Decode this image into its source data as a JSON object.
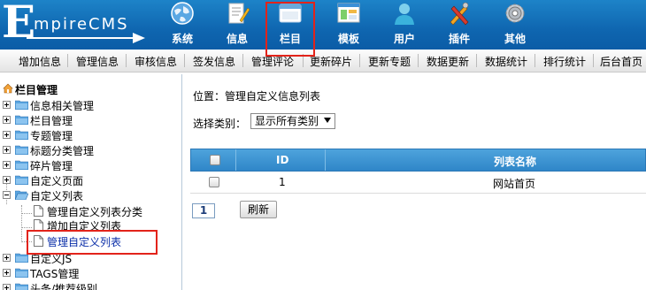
{
  "logo": {
    "big_letter": "E",
    "rest": "mpireCMS"
  },
  "nav": [
    {
      "label": "系统",
      "icon": "globe-icon"
    },
    {
      "label": "信息",
      "icon": "notepad-icon"
    },
    {
      "label": "栏目",
      "icon": "window-icon"
    },
    {
      "label": "模板",
      "icon": "template-window-icon"
    },
    {
      "label": "用户",
      "icon": "user-icon"
    },
    {
      "label": "插件",
      "icon": "plugin-tools-icon"
    },
    {
      "label": "其他",
      "icon": "gear-icon"
    }
  ],
  "submenu": [
    "增加信息",
    "管理信息",
    "审核信息",
    "签发信息",
    "管理评论",
    "更新碎片",
    "更新专题",
    "数据更新",
    "数据统计",
    "排行统计",
    "后台首页"
  ],
  "sidebar": {
    "title": "栏目管理",
    "items": [
      {
        "label": "信息相关管理"
      },
      {
        "label": "栏目管理"
      },
      {
        "label": "专题管理"
      },
      {
        "label": "标题分类管理"
      },
      {
        "label": "碎片管理"
      },
      {
        "label": "自定义页面"
      },
      {
        "label": "自定义列表"
      },
      {
        "label": "管理自定义列表分类"
      },
      {
        "label": "增加自定义列表"
      },
      {
        "label": "管理自定义列表"
      },
      {
        "label": "自定义JS"
      },
      {
        "label": "TAGS管理"
      },
      {
        "label": "头条/推荐级别"
      }
    ]
  },
  "main": {
    "location_prefix": "位置：",
    "location_link": "管理自定义信息列表",
    "filter_label": "选择类别：",
    "filter_value": "显示所有类别",
    "table": {
      "headers": [
        "ID",
        "列表名称"
      ],
      "rows": [
        {
          "id": "1",
          "name": "网站首页"
        }
      ]
    },
    "pager_value": "1",
    "refresh_label": "刷新"
  }
}
